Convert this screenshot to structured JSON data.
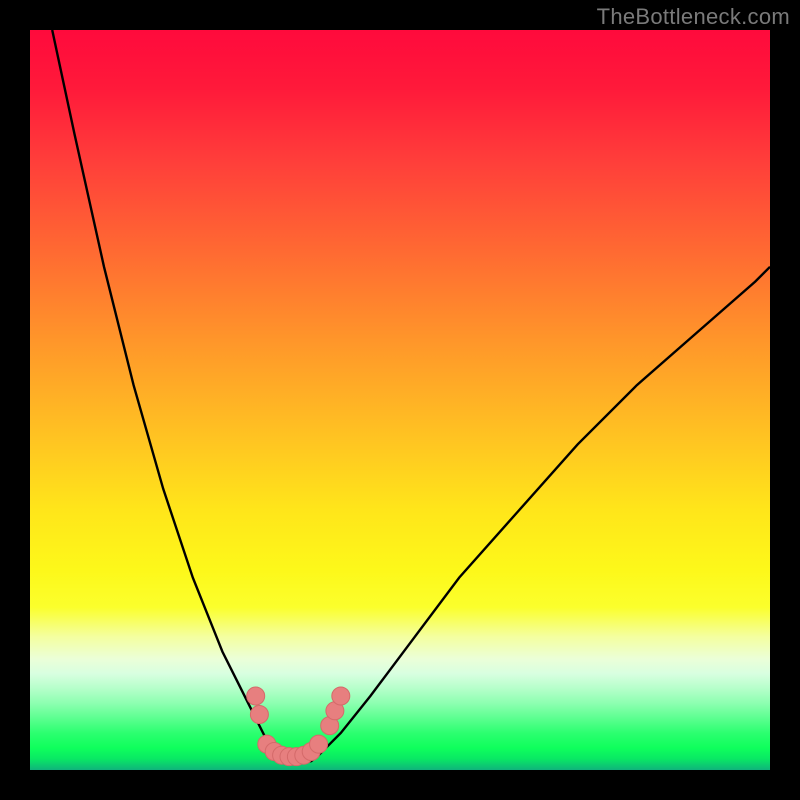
{
  "watermark": "TheBottleneck.com",
  "chart_data": {
    "type": "line",
    "title": "",
    "xlabel": "",
    "ylabel": "",
    "xlim": [
      0,
      100
    ],
    "ylim": [
      0,
      100
    ],
    "grid": false,
    "series": [
      {
        "name": "bottleneck-curve",
        "x": [
          3,
          6,
          10,
          14,
          18,
          22,
          26,
          28,
          30,
          31,
          32,
          33,
          34,
          35,
          36,
          37,
          38,
          39,
          40,
          42,
          46,
          52,
          58,
          66,
          74,
          82,
          90,
          98,
          100
        ],
        "y": [
          100,
          86,
          68,
          52,
          38,
          26,
          16,
          12,
          8,
          6,
          4,
          3,
          2,
          1.5,
          1,
          1,
          1.2,
          2,
          3,
          5,
          10,
          18,
          26,
          35,
          44,
          52,
          59,
          66,
          68
        ]
      }
    ],
    "markers": [
      {
        "x": 30.5,
        "y": 10
      },
      {
        "x": 31,
        "y": 7.5
      },
      {
        "x": 32,
        "y": 3.5
      },
      {
        "x": 33,
        "y": 2.5
      },
      {
        "x": 34,
        "y": 2
      },
      {
        "x": 35,
        "y": 1.8
      },
      {
        "x": 36,
        "y": 1.8
      },
      {
        "x": 37,
        "y": 2
      },
      {
        "x": 38,
        "y": 2.5
      },
      {
        "x": 39,
        "y": 3.5
      },
      {
        "x": 40.5,
        "y": 6
      },
      {
        "x": 41.2,
        "y": 8
      },
      {
        "x": 42,
        "y": 10
      }
    ],
    "colors": {
      "curve": "#000000",
      "marker_fill": "#e77f7f",
      "marker_stroke": "#d46a6a"
    }
  }
}
